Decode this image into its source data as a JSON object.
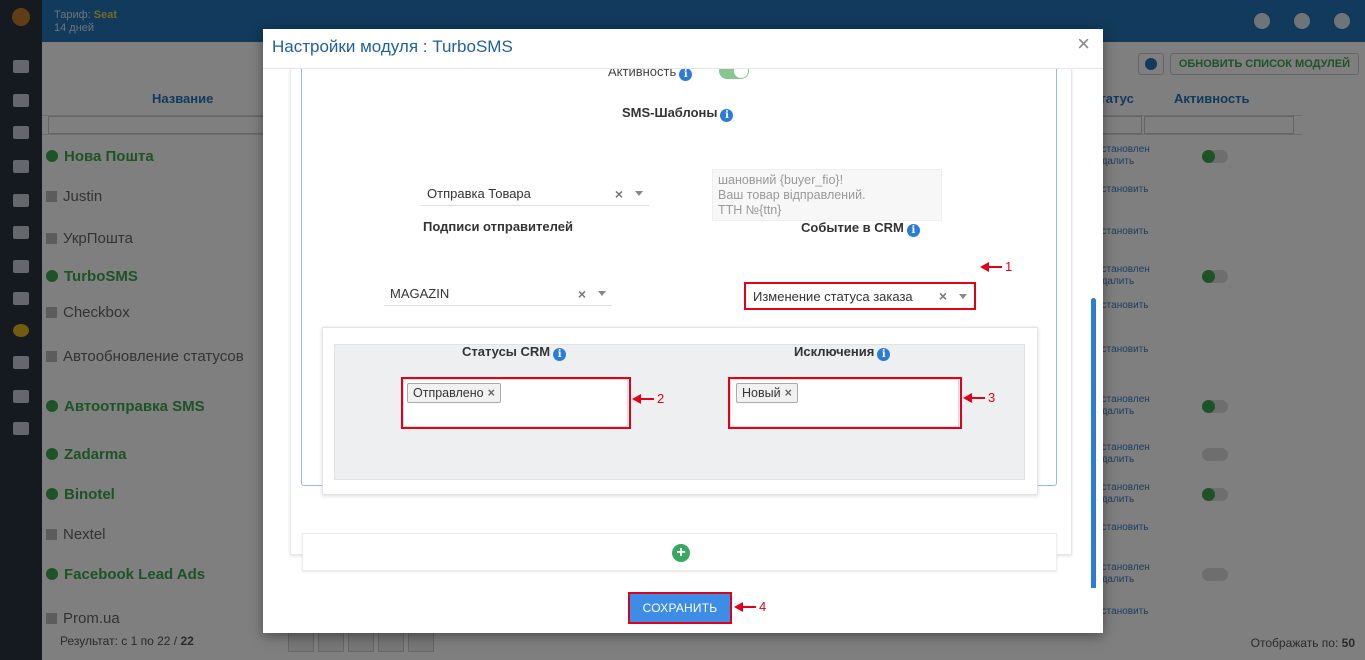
{
  "topbar": {
    "plan_label": "Тариф:",
    "plan_name": "Seat",
    "days": "14 дней"
  },
  "toolbar": {
    "refresh_label": "ОБНОВИТЬ СПИСОК МОДУЛЕЙ"
  },
  "table": {
    "col_name": "Название",
    "col_status": "Статус",
    "col_active": "Активность",
    "modules": [
      {
        "name": "Нова Пошта",
        "enabled": true,
        "status": "Установлен",
        "action": "Удалить",
        "active": true
      },
      {
        "name": "Justin",
        "enabled": false,
        "action": "Установить"
      },
      {
        "name": "УкрПошта",
        "enabled": false,
        "action": "Установить"
      },
      {
        "name": "TurboSMS",
        "enabled": true,
        "status": "Установлен",
        "action": "Удалить",
        "active": true
      },
      {
        "name": "Checkbox",
        "enabled": false,
        "action": "Установить"
      },
      {
        "name": "Автообновление статусов",
        "enabled": false,
        "action": "Установить"
      },
      {
        "name": "Автоотправка SMS",
        "enabled": true,
        "status": "Установлен",
        "action": "Удалить",
        "active": true
      },
      {
        "name": "Zadarma",
        "enabled": true,
        "status": "Установлен",
        "action": "Удалить",
        "active": false
      },
      {
        "name": "Binotel",
        "enabled": true,
        "status": "Установлен",
        "action": "Удалить",
        "active": true
      },
      {
        "name": "Nextel",
        "enabled": false,
        "action": "Установить"
      },
      {
        "name": "Facebook Lead Ads",
        "enabled": true,
        "status": "Установлен",
        "action": "Удалить",
        "active": false
      },
      {
        "name": "Prom.ua",
        "enabled": false,
        "action": "Установить"
      }
    ],
    "result_label": "Результат: с 1 по 22 / ",
    "result_total": "22",
    "per_page_label": "Отображать по:",
    "per_page_value": "50"
  },
  "modal": {
    "title": "Настройки модуля : TurboSMS",
    "close_glyph": "×",
    "activity_label": "Активность",
    "activity_on": true,
    "templates_label": "SMS-Шаблоны",
    "template_select": "Отправка Товара",
    "template_text": "шановний {buyer_fio}!\nВаш товар відправлений.\nТТН №{ttn}",
    "senders_label": "Подписи отправителей",
    "sender_select": "MAGAZIN",
    "crm_event_label": "Событие в CRM",
    "crm_event_select": "Изменение статуса заказа",
    "crm_statuses_label": "Статусы CRM",
    "crm_statuses_tags": [
      "Отправлено"
    ],
    "exclusions_label": "Исключения",
    "exclusions_tags": [
      "Новый"
    ],
    "add_glyph": "+",
    "clear_glyph": "×",
    "save_label": "СОХРАНИТЬ"
  },
  "annotations": [
    "1",
    "2",
    "3",
    "4"
  ],
  "colors": {
    "primary": "#2474b8",
    "success": "#3aa74a",
    "highlight": "#e0001b",
    "save": "#3d8ce6"
  }
}
